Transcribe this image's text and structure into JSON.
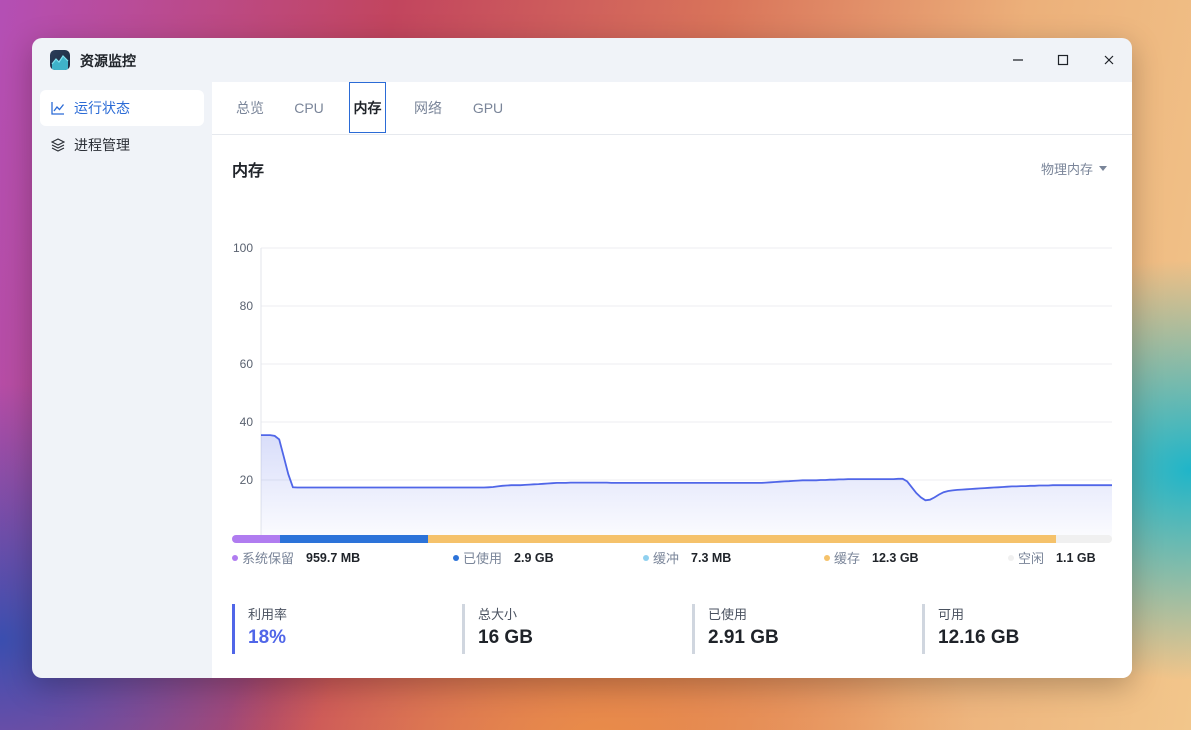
{
  "window": {
    "title": "资源监控"
  },
  "sidebar": {
    "items": [
      {
        "label": "运行状态",
        "active": true,
        "icon": "line-chart-icon"
      },
      {
        "label": "进程管理",
        "active": false,
        "icon": "layers-icon"
      }
    ]
  },
  "tabs": [
    {
      "label": "总览",
      "active": false
    },
    {
      "label": "CPU",
      "active": false
    },
    {
      "label": "内存",
      "active": true
    },
    {
      "label": "网络",
      "active": false
    },
    {
      "label": "GPU",
      "active": false
    }
  ],
  "section": {
    "title": "内存",
    "selector": "物理内存"
  },
  "colors": {
    "accent": "#2b6bd6",
    "line": "#5066e8",
    "reserved": "#b07cf0",
    "used": "#2c73d9",
    "buffer": "#8fd0ef",
    "cache": "#f5c26b",
    "free": "#f0f0f0"
  },
  "chart_data": {
    "type": "area",
    "ylim": [
      0,
      100
    ],
    "yticks": [
      "100",
      "80",
      "60",
      "40",
      "20"
    ],
    "grid": true,
    "series": [
      {
        "values": [
          35.5,
          35.5,
          35.5,
          35.2,
          34,
          28,
          22,
          17.5,
          17.4,
          17.4,
          17.4,
          17.4,
          17.4,
          17.4,
          17.4,
          17.4,
          17.4,
          17.4,
          17.4,
          17.4,
          17.4,
          17.4,
          17.4,
          17.4,
          17.4,
          17.4,
          17.4,
          17.4,
          17.4,
          17.4,
          17.4,
          17.4,
          17.4,
          17.4,
          17.4,
          17.4,
          17.4,
          17.4,
          17.4,
          17.4,
          17.4,
          17.4,
          17.4,
          17.4,
          17.4,
          17.4,
          17.4,
          17.4,
          17.4,
          17.4,
          17.5,
          17.6,
          17.8,
          18.0,
          18.1,
          18.2,
          18.2,
          18.2,
          18.3,
          18.4,
          18.5,
          18.6,
          18.7,
          18.8,
          18.9,
          19.0,
          19.0,
          19.0,
          19.1,
          19.1,
          19.1,
          19.1,
          19.1,
          19.1,
          19.1,
          19.1,
          19.1,
          19.0,
          19.0,
          19.0,
          19.0,
          19.0,
          19.0,
          19.0,
          19.0,
          19.0,
          19.0,
          19.0,
          19.0,
          19.0,
          19.0,
          19.0,
          19.0,
          19.0,
          19.0,
          19.0,
          19.0,
          19.0,
          19.0,
          19.0,
          19.0,
          19.0,
          19.0,
          19.0,
          19.0,
          19.0,
          19.0,
          19.0,
          19.0,
          19.0,
          19.0,
          19.1,
          19.2,
          19.3,
          19.4,
          19.5,
          19.6,
          19.7,
          19.8,
          19.9,
          19.9,
          19.9,
          19.9,
          20.0,
          20.0,
          20.1,
          20.1,
          20.2,
          20.2,
          20.3,
          20.3,
          20.3,
          20.3,
          20.3,
          20.3,
          20.3,
          20.3,
          20.3,
          20.3,
          20.3,
          20.4,
          20.4,
          19.5,
          17.5,
          15.5,
          14.0,
          13.0,
          13.2,
          14.0,
          15.0,
          15.8,
          16.2,
          16.4,
          16.6,
          16.7,
          16.8,
          16.9,
          17.0,
          17.1,
          17.2,
          17.3,
          17.4,
          17.5,
          17.6,
          17.7,
          17.8,
          17.8,
          17.9,
          17.9,
          18.0,
          18.0,
          18.1,
          18.1,
          18.1,
          18.2,
          18.2,
          18.2,
          18.2,
          18.2,
          18.2,
          18.2,
          18.2,
          18.2,
          18.2,
          18.2,
          18.2,
          18.2,
          18.2
        ]
      }
    ]
  },
  "memory_bar": [
    {
      "name": "系统保留",
      "value": "959.7 MB",
      "fraction": 0.0547,
      "color": "#b07cf0"
    },
    {
      "name": "已使用",
      "value": "2.9 GB",
      "fraction": 0.1677,
      "color": "#2c73d9"
    },
    {
      "name": "缓冲",
      "value": "7.3 MB",
      "fraction": 0.0005,
      "color": "#8fd0ef"
    },
    {
      "name": "缓存",
      "value": "12.3 GB",
      "fraction": 0.714,
      "color": "#f5c26b"
    },
    {
      "name": "空闲",
      "value": "1.1 GB",
      "fraction": 0.0631,
      "color": "#f0f0f0"
    }
  ],
  "stats": [
    {
      "label": "利用率",
      "value": "18%"
    },
    {
      "label": "总大小",
      "value": "16 GB"
    },
    {
      "label": "已使用",
      "value": "2.91 GB"
    },
    {
      "label": "可用",
      "value": "12.16 GB"
    }
  ]
}
